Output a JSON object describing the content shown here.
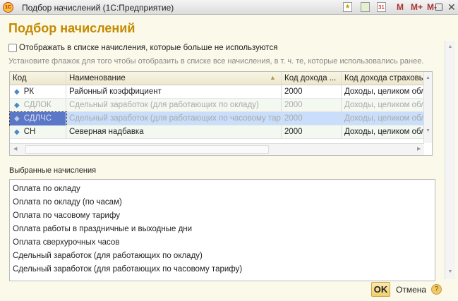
{
  "window": {
    "title": "Подбор начислений  (1С:Предприятие)",
    "logo": "1С",
    "toolbar": [
      "favorite-icon",
      "calculator-icon",
      "calendar-icon",
      "M",
      "M+",
      "M-",
      "maximize-icon",
      "close-icon"
    ],
    "calendar_day": "31"
  },
  "heading": "Подбор начислений",
  "checkbox": {
    "label": "Отображать в списке начисления, которые больше не используются",
    "checked": false
  },
  "hint": "Установите флажок для того чтобы отобразить в списке все начисления, в т. ч. те, которые использовались ранее.",
  "table": {
    "columns": [
      "Код",
      "Наименование",
      "Код дохода ...",
      "Код дохода страховы"
    ],
    "rows": [
      {
        "code": "РК",
        "name": "Районный коэффициент",
        "income": "2000",
        "insurance": "Доходы, целиком обл"
      },
      {
        "code": "СДЛОК",
        "name": "Сдельный заработок (для работающих по окладу)",
        "income": "2000",
        "insurance": "Доходы, целиком обл"
      },
      {
        "code": "СДЛЧС",
        "name": "Сдельный заработок (для работающих по часовому тар...",
        "income": "2000",
        "insurance": "Доходы, целиком обл"
      },
      {
        "code": "СН",
        "name": "Северная надбавка",
        "income": "2000",
        "insurance": "Доходы, целиком обл"
      }
    ]
  },
  "selected": {
    "label": "Выбранные начисления",
    "items": [
      "Оплата по окладу",
      "Оплата по окладу (по часам)",
      "Оплата по часовому тарифу",
      "Оплата работы в праздничные и выходные дни",
      "Оплата сверхурочных часов",
      "Сдельный заработок (для работающих по окладу)",
      "Сдельный заработок (для работающих по часовому тарифу)"
    ]
  },
  "buttons": {
    "ok": "OK",
    "cancel": "Отмена",
    "help": "?"
  }
}
